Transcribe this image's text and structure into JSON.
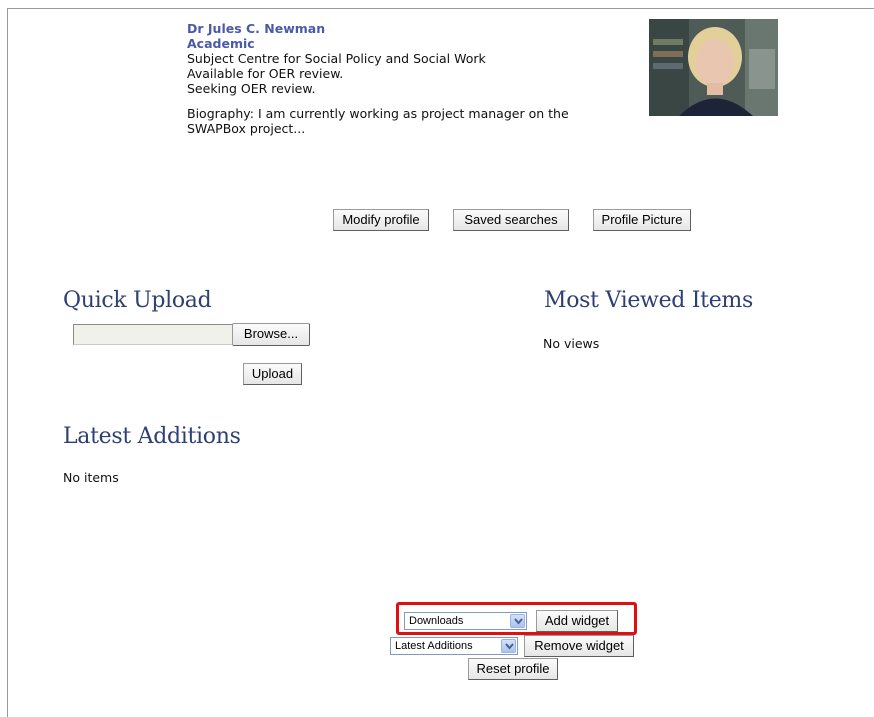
{
  "profile": {
    "name": "Dr Jules C. Newman",
    "role": "Academic",
    "department": "Subject Centre for Social Policy and Social Work",
    "review_available": "Available for OER review.",
    "review_seeking": "Seeking OER review.",
    "biography_line1": "Biography: I am currently working as project manager on the",
    "biography_line2": "SWAPBox project..."
  },
  "profile_buttons": {
    "modify": "Modify profile",
    "saved_searches": "Saved searches",
    "profile_picture": "Profile Picture"
  },
  "quick_upload": {
    "title": "Quick Upload",
    "browse_label": "Browse...",
    "upload_label": "Upload",
    "file_value": ""
  },
  "most_viewed": {
    "title": "Most Viewed Items",
    "empty_text": "No views"
  },
  "latest_additions": {
    "title": "Latest Additions",
    "empty_text": "No items"
  },
  "widgets": {
    "add_select_value": "Downloads",
    "add_label": "Add widget",
    "remove_select_value": "Latest Additions",
    "remove_label": "Remove widget",
    "reset_label": "Reset profile",
    "highlight_color": "#e01010"
  }
}
